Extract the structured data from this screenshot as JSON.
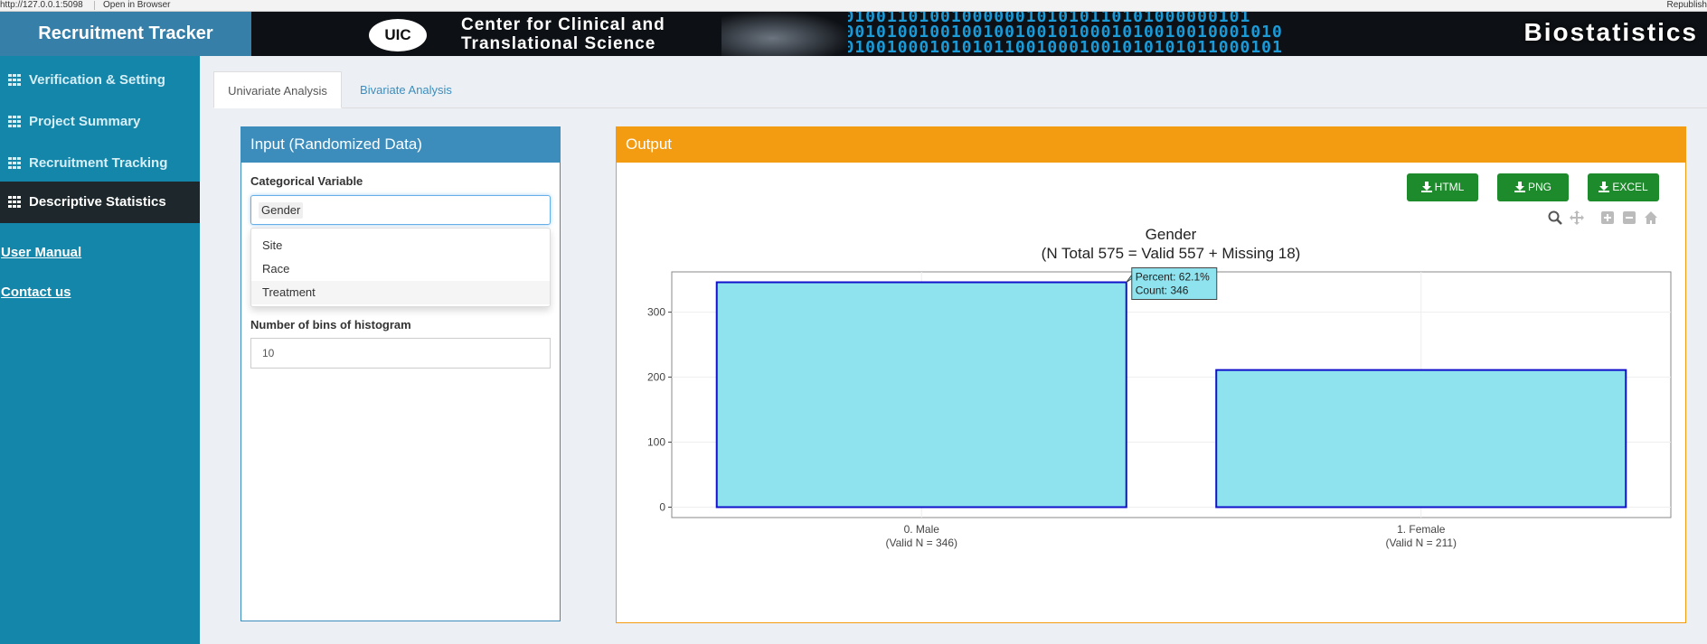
{
  "browser": {
    "url": "http://127.0.0.1:5098",
    "open_in_browser": "Open in Browser",
    "republish": "Republish"
  },
  "header": {
    "app_title": "Recruitment Tracker",
    "banner_logo": "UIC",
    "banner_line1": "Center for Clinical and",
    "banner_line2": "Translational Science",
    "banner_right": "Biostatistics",
    "banner_bits": "10101001101001000000101010110101000000101\n01000101001001001001001010001010010010001010\n11001001000101010110010001001010101011000101"
  },
  "sidebar": {
    "items": [
      {
        "label": "Verification & Setting",
        "icon": "grid-icon",
        "active": false
      },
      {
        "label": "Project Summary",
        "icon": "grid-icon",
        "active": false
      },
      {
        "label": "Recruitment Tracking",
        "icon": "grid-icon",
        "active": false
      },
      {
        "label": "Descriptive Statistics",
        "icon": "grid-icon",
        "active": true
      }
    ],
    "links": [
      "User Manual",
      "Contact us"
    ]
  },
  "tabs": [
    {
      "label": "Univariate Analysis",
      "active": true
    },
    {
      "label": "Bivariate Analysis",
      "active": false
    }
  ],
  "input_panel": {
    "title": "Input (Randomized Data)",
    "categorical_label": "Categorical Variable",
    "selected_value": "Gender",
    "dropdown_options": [
      "Site",
      "Race",
      "Treatment"
    ],
    "bins_label": "Number of bins of histogram",
    "bins_value": "10"
  },
  "output_panel": {
    "title": "Output",
    "buttons": [
      "HTML",
      "PNG",
      "EXCEL"
    ],
    "modebar_icons": [
      "zoom-icon",
      "pan-icon",
      "zoom-in-icon",
      "zoom-out-icon",
      "home-icon"
    ]
  },
  "colors": {
    "sidebar_bg": "#1386a9",
    "sidebar_active": "#1e282c",
    "primary": "#3c8dbc",
    "warning": "#f39c12",
    "success": "#1d8a2b",
    "bar_fill": "#8fe3ee",
    "bar_stroke": "#1111cc"
  },
  "chart_data": {
    "type": "bar",
    "title": "Gender",
    "subtitle": "(N Total 575 = Valid 557 + Missing 18)",
    "categories": [
      "0. Male",
      "1. Female"
    ],
    "category_sublabels": [
      "(Valid N = 346)",
      "(Valid N = 211)"
    ],
    "values": [
      346,
      211
    ],
    "yticks": [
      0,
      100,
      200,
      300
    ],
    "ylim": [
      -16,
      362
    ],
    "grid": true,
    "tooltip": {
      "category_index": 0,
      "line1": "Percent: 62.1%",
      "line2": "Count: 346"
    }
  }
}
